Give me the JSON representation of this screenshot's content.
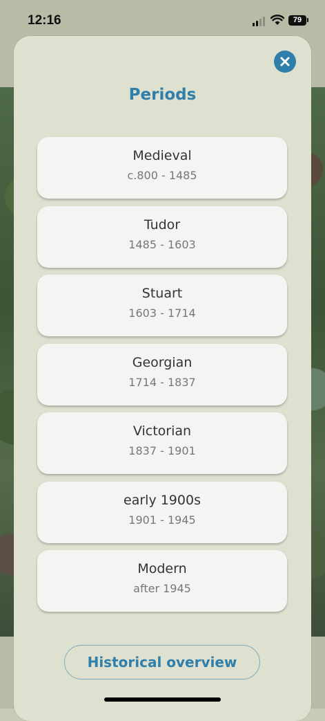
{
  "status_bar": {
    "time": "12:16",
    "battery": "79"
  },
  "modal": {
    "title": "Periods",
    "periods": [
      {
        "name": "Medieval",
        "range": "c.800 - 1485"
      },
      {
        "name": "Tudor",
        "range": "1485 - 1603"
      },
      {
        "name": "Stuart",
        "range": "1603 - 1714"
      },
      {
        "name": "Georgian",
        "range": "1714 - 1837"
      },
      {
        "name": "Victorian",
        "range": "1837 - 1901"
      },
      {
        "name": "early 1900s",
        "range": "1901 - 1945"
      },
      {
        "name": "Modern",
        "range": "after 1945"
      }
    ],
    "overview_label": "Historical overview"
  },
  "colors": {
    "accent": "#2f7faa",
    "modal_bg": "#dfe1d0",
    "card_bg": "#f4f4f3"
  },
  "icons": {
    "close": "close-icon",
    "signal": "cellular-signal-icon",
    "wifi": "wifi-icon",
    "battery": "battery-icon"
  }
}
